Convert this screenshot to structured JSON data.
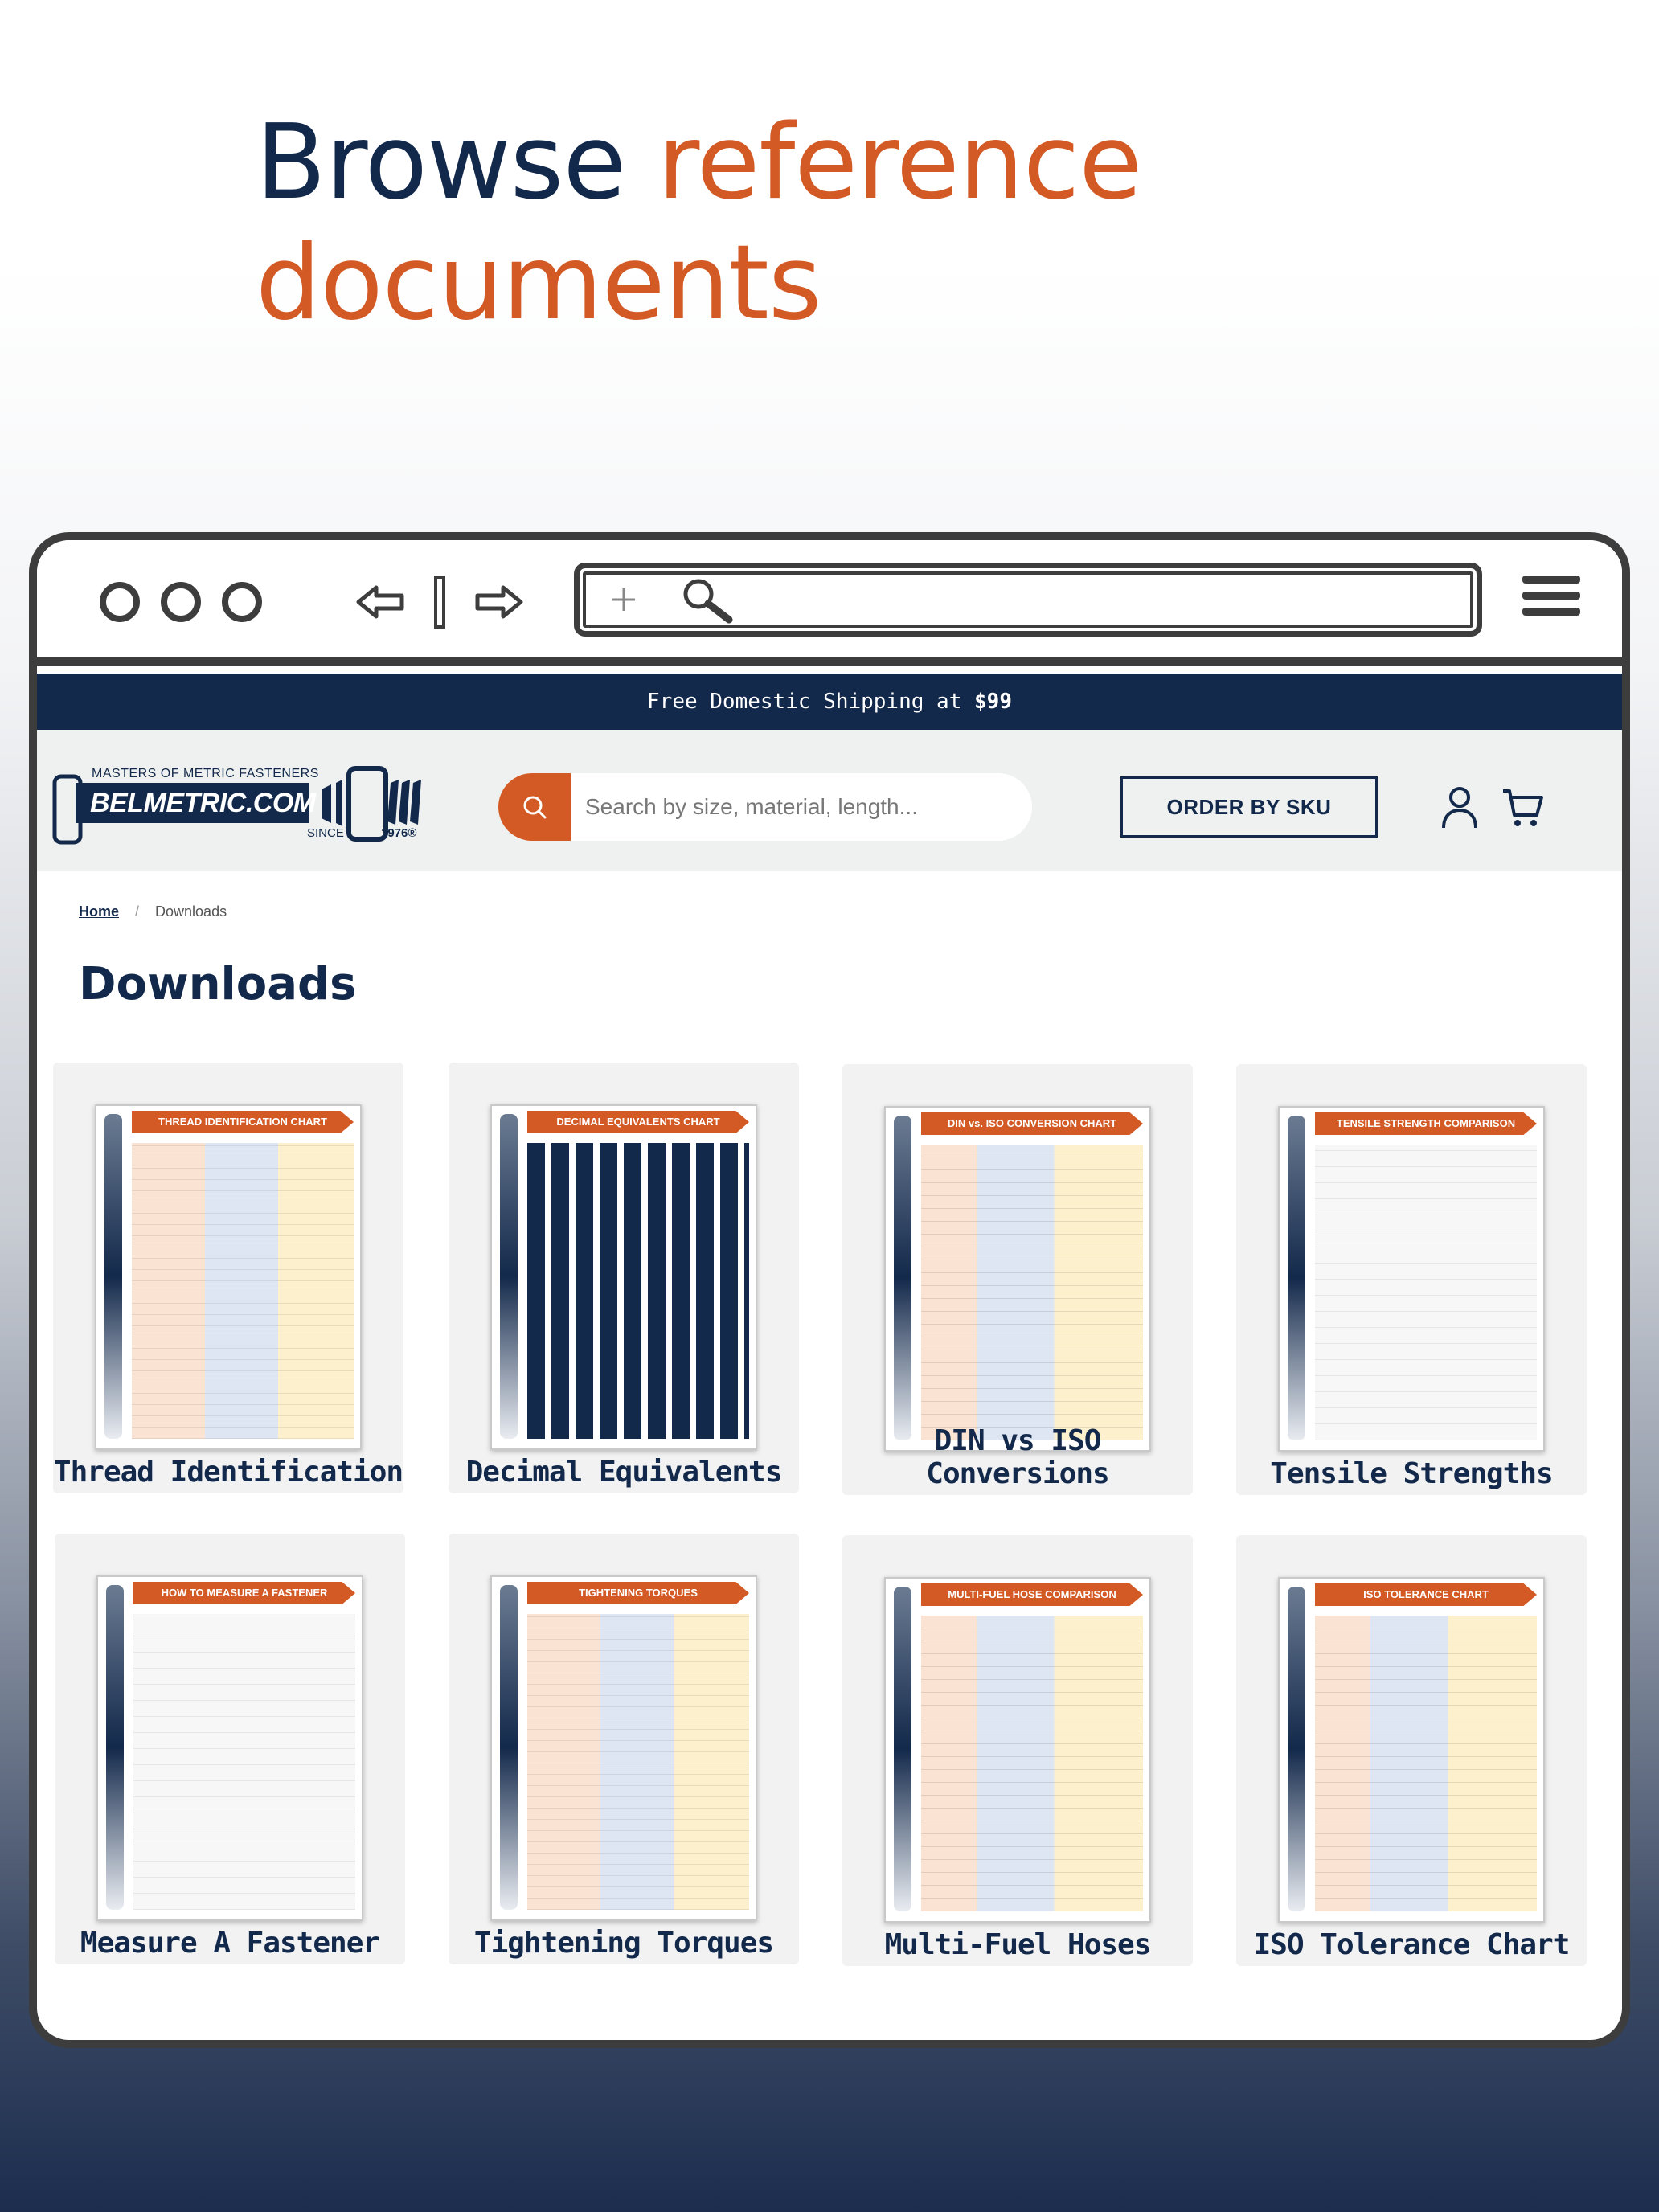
{
  "headline": {
    "part1": "Browse ",
    "part2": "reference",
    "part3": "documents"
  },
  "colors": {
    "navy": "#13294b",
    "accent": "#d35a25",
    "header_bg": "#eef1ef"
  },
  "browser": {
    "icons": [
      "window-dot-icon",
      "back-arrow-icon",
      "forward-arrow-icon",
      "plus-icon",
      "search-icon",
      "hamburger-menu-icon"
    ]
  },
  "shipping_bar": {
    "text": "Free Domestic Shipping at ",
    "amount": "$99"
  },
  "header": {
    "logo": {
      "tagline": "MASTERS OF METRIC FASTENERS",
      "name": "BELMETRIC.COM",
      "since": "SINCE",
      "year": "1976®"
    },
    "search": {
      "placeholder": "Search by size, material, length..."
    },
    "order_by_sku": "ORDER BY SKU",
    "icons": [
      "account-icon",
      "cart-icon"
    ]
  },
  "breadcrumb": {
    "home": "Home",
    "current": "Downloads"
  },
  "page_title": "Downloads",
  "downloads": [
    {
      "label": "Thread Identification",
      "banner": "THREAD IDENTIFICATION CHART"
    },
    {
      "label": "Decimal Equivalents",
      "banner": "DECIMAL EQUIVALENTS CHART"
    },
    {
      "label": "DIN vs ISO Conversions",
      "banner": "DIN vs. ISO CONVERSION CHART"
    },
    {
      "label": "Tensile Strengths",
      "banner": "TENSILE STRENGTH COMPARISON"
    },
    {
      "label": "Measure A Fastener",
      "banner": "HOW TO MEASURE A FASTENER"
    },
    {
      "label": "Tightening Torques",
      "banner": "TIGHTENING TORQUES"
    },
    {
      "label": "Multi-Fuel Hoses",
      "banner": "MULTI-FUEL HOSE COMPARISON"
    },
    {
      "label": "ISO Tolerance Chart",
      "banner": "ISO TOLERANCE CHART"
    }
  ]
}
